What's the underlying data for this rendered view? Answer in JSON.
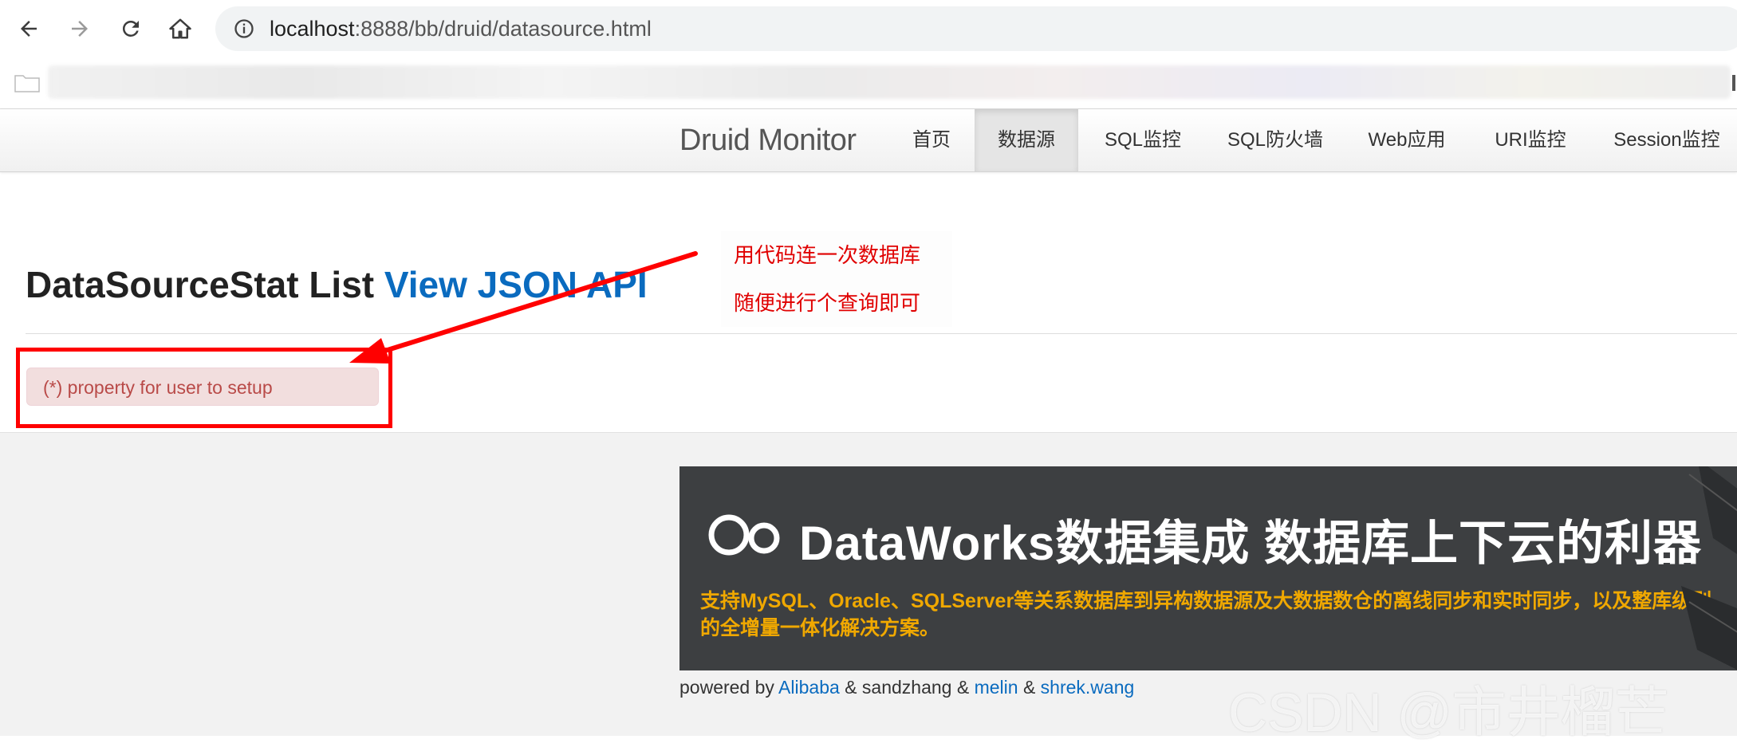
{
  "browser": {
    "url_host": "localhost",
    "url_rest": ":8888/bb/druid/datasource.html"
  },
  "navbar": {
    "brand": "Druid Monitor",
    "items": [
      {
        "label": "首页",
        "active": false
      },
      {
        "label": "数据源",
        "active": true
      },
      {
        "label": "SQL监控",
        "active": false
      },
      {
        "label": "SQL防火墙",
        "active": false
      },
      {
        "label": "Web应用",
        "active": false
      },
      {
        "label": "URI监控",
        "active": false
      },
      {
        "label": "Session监控",
        "active": false
      }
    ]
  },
  "main": {
    "title": "DataSourceStat List",
    "title_link": "View JSON API",
    "alert_text": "(*) property for user to setup"
  },
  "annotation": {
    "line1": "用代码连一次数据库",
    "line2": "随便进行个查询即可",
    "color": "#ff0000"
  },
  "footer": {
    "banner_headline": "DataWorks数据集成 数据库上下云的利器",
    "banner_subline": "支持MySQL、Oracle、SQLServer等关系数据库到异构数据源及大数据数仓的离线同步和实时同步，以及整库级别的全增量一体化解决方案。",
    "powered_by_prefix": "powered by",
    "powered_link_1": "Alibaba",
    "powered_sep_1": "& sandzhang &",
    "powered_link_2": "melin",
    "powered_sep_2": "&",
    "powered_link_3": "shrek.wang"
  },
  "watermark": "CSDN @市井榴芒"
}
